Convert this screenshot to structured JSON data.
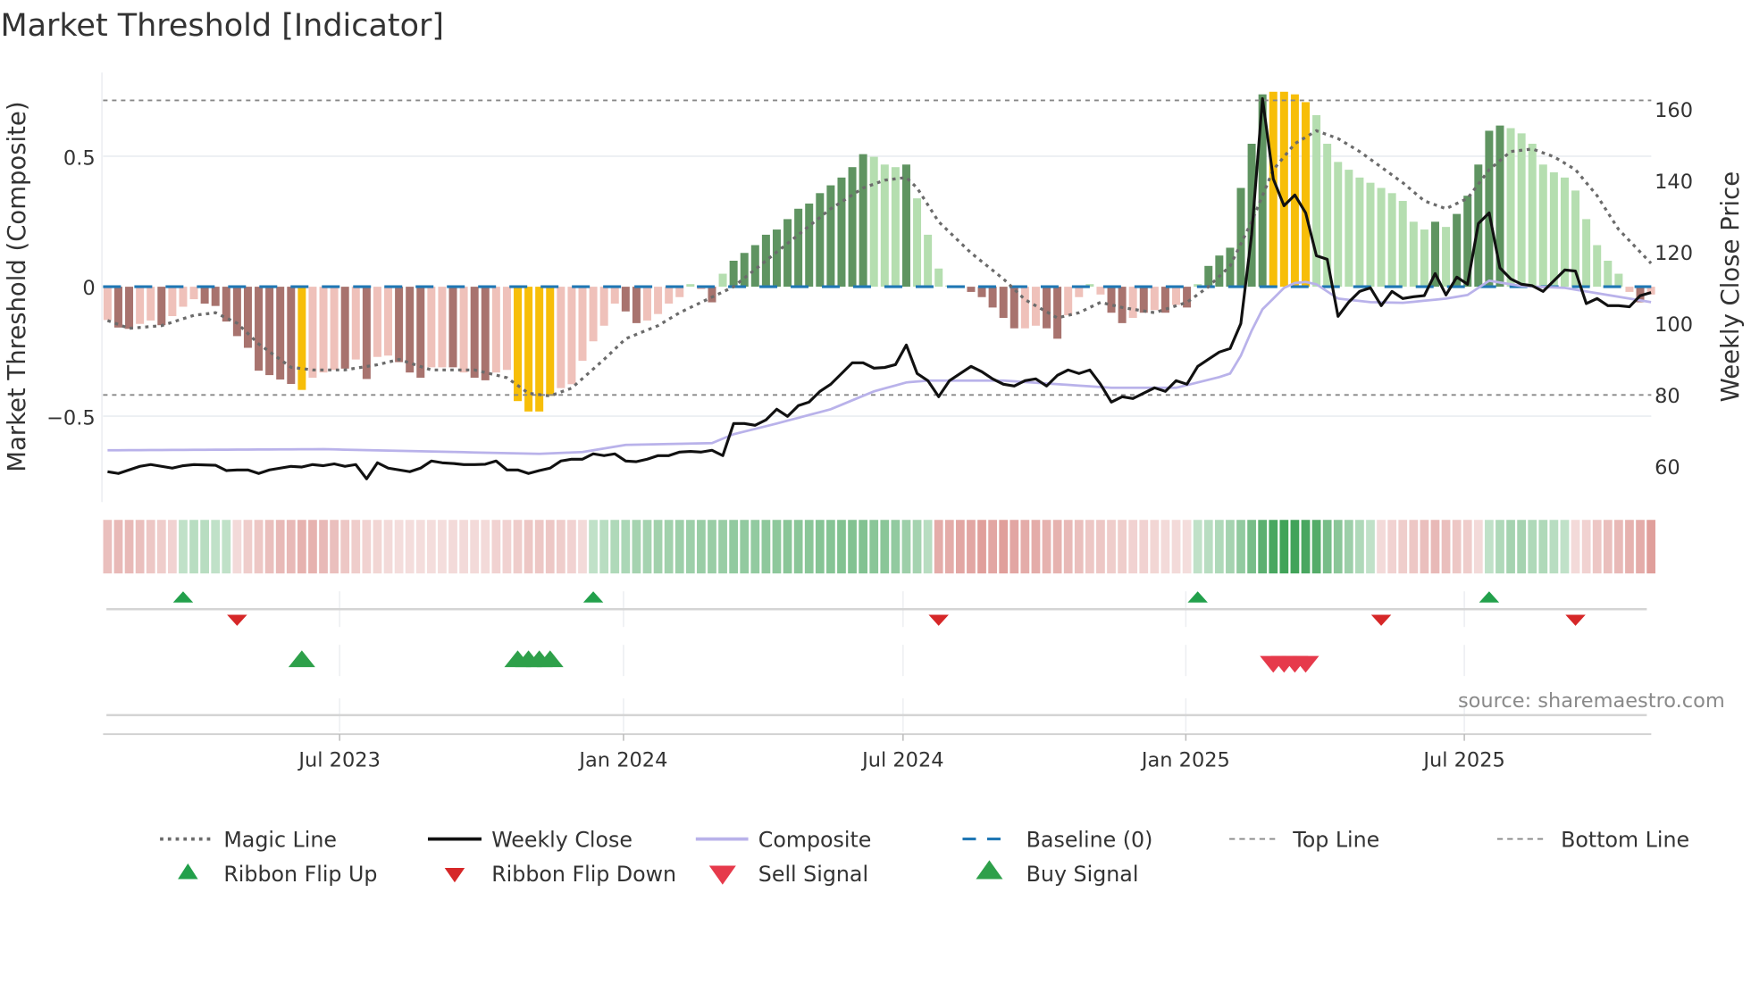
{
  "title": "Market Threshold [Indicator]",
  "source": "source: sharemaestro.com",
  "chart_data": {
    "type": "bar+line",
    "title": "Market Threshold [Indicator]",
    "ylabel_left": "Market Threshold (Composite)",
    "ylabel_right": "Weekly Close Price",
    "ylim_left": [
      -0.82,
      0.82
    ],
    "ylim_right": [
      50,
      170
    ],
    "left_ticks": [
      {
        "label": "0.5",
        "value": 0.5
      },
      {
        "label": "0",
        "value": 0
      },
      {
        "label": "−0.5",
        "value": -0.5
      }
    ],
    "right_ticks": [
      {
        "label": "160",
        "value": 160
      },
      {
        "label": "140",
        "value": 140
      },
      {
        "label": "120",
        "value": 120
      },
      {
        "label": "100",
        "value": 100
      },
      {
        "label": "80",
        "value": 80
      },
      {
        "label": "60",
        "value": 60
      }
    ],
    "x_ticks": [
      {
        "label": "Jul 2023",
        "week": 21.5
      },
      {
        "label": "Jan 2024",
        "week": 47.8
      },
      {
        "label": "Jul 2024",
        "week": 73.7
      },
      {
        "label": "Jan 2025",
        "week": 99.9
      },
      {
        "label": "Jul 2025",
        "week": 125.7
      }
    ],
    "weeks": 144,
    "top_line_price": 162.5,
    "bottom_line_price": 80,
    "baseline": 0,
    "bar_color_key": {
      "D": "#a8736e",
      "L": "#efc1ba",
      "G": "#5f9461",
      "g": "#b5deb0",
      "Y": "#f7be08"
    },
    "bar_codes": "LDDLLDLLLDDDDDDDDDYLLLDLDLLDDDLLDLDDLLYYYYLLLLLLDDLLLLgLDgGGGGGGGGGGGGGgggGggggLDDDDDLLDDLLgLDDLDLDLDgGGGGGGYYYYgggggggggggGgGGGGGgggggggggggLDL",
    "composite_bars": [
      -0.128,
      -0.157,
      -0.162,
      -0.143,
      -0.13,
      -0.148,
      -0.113,
      -0.077,
      -0.048,
      -0.065,
      -0.074,
      -0.134,
      -0.19,
      -0.235,
      -0.323,
      -0.34,
      -0.357,
      -0.374,
      -0.397,
      -0.35,
      -0.33,
      -0.32,
      -0.315,
      -0.28,
      -0.355,
      -0.27,
      -0.265,
      -0.29,
      -0.33,
      -0.35,
      -0.31,
      -0.31,
      -0.31,
      -0.33,
      -0.35,
      -0.36,
      -0.33,
      -0.32,
      -0.44,
      -0.48,
      -0.48,
      -0.42,
      -0.39,
      -0.375,
      -0.285,
      -0.21,
      -0.15,
      -0.065,
      -0.095,
      -0.14,
      -0.13,
      -0.105,
      -0.065,
      -0.04,
      0.01,
      -0.01,
      -0.06,
      0.05,
      0.1,
      0.13,
      0.16,
      0.2,
      0.22,
      0.26,
      0.3,
      0.32,
      0.36,
      0.39,
      0.42,
      0.46,
      0.51,
      0.5,
      0.47,
      0.46,
      0.47,
      0.34,
      0.2,
      0.07,
      0.005,
      -0.005,
      -0.02,
      -0.04,
      -0.08,
      -0.12,
      -0.16,
      -0.16,
      -0.15,
      -0.16,
      -0.2,
      -0.11,
      -0.04,
      0.01,
      -0.03,
      -0.1,
      -0.14,
      -0.12,
      -0.1,
      -0.09,
      -0.1,
      -0.07,
      -0.08,
      0.01,
      0.08,
      0.12,
      0.15,
      0.38,
      0.55,
      0.74,
      0.75,
      0.75,
      0.74,
      0.71,
      0.66,
      0.55,
      0.48,
      0.45,
      0.42,
      0.4,
      0.38,
      0.36,
      0.33,
      0.25,
      0.22,
      0.25,
      0.23,
      0.28,
      0.35,
      0.47,
      0.6,
      0.62,
      0.61,
      0.59,
      0.55,
      0.47,
      0.44,
      0.42,
      0.37,
      0.26,
      0.16,
      0.1,
      0.05,
      -0.02,
      -0.06,
      -0.03
    ],
    "magic_line_points": [
      [
        0,
        -0.13
      ],
      [
        2,
        -0.16
      ],
      [
        5,
        -0.15
      ],
      [
        8,
        -0.11
      ],
      [
        10,
        -0.1
      ],
      [
        12,
        -0.14
      ],
      [
        14,
        -0.22
      ],
      [
        17,
        -0.31
      ],
      [
        19,
        -0.32
      ],
      [
        22,
        -0.32
      ],
      [
        25,
        -0.3
      ],
      [
        27,
        -0.28
      ],
      [
        30,
        -0.32
      ],
      [
        34,
        -0.32
      ],
      [
        37,
        -0.35
      ],
      [
        39,
        -0.41
      ],
      [
        41,
        -0.42
      ],
      [
        43,
        -0.39
      ],
      [
        46,
        -0.28
      ],
      [
        48,
        -0.2
      ],
      [
        51,
        -0.15
      ],
      [
        53,
        -0.1
      ],
      [
        56,
        -0.04
      ],
      [
        58,
        0.0
      ],
      [
        61,
        0.1
      ],
      [
        64,
        0.2
      ],
      [
        67,
        0.3
      ],
      [
        70,
        0.38
      ],
      [
        72,
        0.41
      ],
      [
        74,
        0.42
      ],
      [
        75,
        0.38
      ],
      [
        77,
        0.25
      ],
      [
        80,
        0.13
      ],
      [
        83,
        0.03
      ],
      [
        85,
        -0.05
      ],
      [
        88,
        -0.12
      ],
      [
        90,
        -0.1
      ],
      [
        92,
        -0.06
      ],
      [
        94,
        -0.08
      ],
      [
        97,
        -0.1
      ],
      [
        100,
        -0.06
      ],
      [
        102,
        0.0
      ],
      [
        104,
        0.08
      ],
      [
        106,
        0.25
      ],
      [
        108,
        0.45
      ],
      [
        110,
        0.55
      ],
      [
        112,
        0.6
      ],
      [
        114,
        0.57
      ],
      [
        116,
        0.52
      ],
      [
        118,
        0.46
      ],
      [
        120,
        0.4
      ],
      [
        122,
        0.33
      ],
      [
        124,
        0.3
      ],
      [
        126,
        0.34
      ],
      [
        128,
        0.45
      ],
      [
        130,
        0.52
      ],
      [
        132,
        0.53
      ],
      [
        134,
        0.5
      ],
      [
        136,
        0.45
      ],
      [
        138,
        0.35
      ],
      [
        140,
        0.22
      ],
      [
        143,
        0.09
      ]
    ],
    "weekly_close": [
      58.5,
      58,
      59,
      60,
      60.5,
      60,
      59.5,
      60.2,
      60.5,
      60.4,
      60.3,
      58.8,
      59,
      59,
      58,
      59,
      59.5,
      60,
      59.8,
      60.5,
      60.2,
      60.7,
      60,
      60.5,
      56.5,
      61,
      59.5,
      59,
      58.5,
      59.5,
      61.5,
      61,
      60.8,
      60.5,
      60.5,
      60.6,
      61.5,
      59,
      59,
      58,
      58.8,
      59.5,
      61.5,
      62,
      62,
      63.5,
      63,
      63.5,
      61.5,
      61.3,
      62,
      63,
      63,
      64,
      64.2,
      64,
      64.5,
      63,
      72,
      72,
      71.5,
      73,
      76,
      74,
      77,
      78,
      81,
      83,
      86,
      89,
      89,
      87.5,
      87.7,
      88.5,
      94,
      86,
      84,
      79.5,
      84,
      86,
      88,
      86.5,
      84.5,
      83,
      82.5,
      84,
      84.5,
      82.5,
      85.5,
      87,
      86,
      87,
      83,
      78,
      79.5,
      79,
      80.5,
      82,
      81,
      84,
      83,
      88,
      90,
      92,
      93,
      100,
      125,
      163,
      140.5,
      133,
      136,
      131,
      119,
      118,
      102,
      106,
      109,
      110,
      105,
      109,
      107,
      107.5,
      107.8,
      114,
      108,
      113,
      111,
      128,
      131,
      115.6,
      112.5,
      111,
      110.6,
      109,
      112,
      115,
      114.7,
      105.6,
      107,
      105,
      105,
      104.7,
      107.8,
      108.7
    ],
    "composite_line_points": [
      [
        0,
        64.5
      ],
      [
        20,
        64.8
      ],
      [
        40,
        63.5
      ],
      [
        44,
        64
      ],
      [
        48,
        66
      ],
      [
        56,
        66.5
      ],
      [
        58,
        69
      ],
      [
        62,
        72
      ],
      [
        67,
        76
      ],
      [
        71,
        81
      ],
      [
        74,
        83.5
      ],
      [
        76,
        84
      ],
      [
        83,
        84
      ],
      [
        88,
        83
      ],
      [
        93,
        82
      ],
      [
        99,
        82
      ],
      [
        103,
        85
      ],
      [
        104,
        86
      ],
      [
        105,
        91
      ],
      [
        106,
        98
      ],
      [
        107,
        104
      ],
      [
        109,
        110
      ],
      [
        110.5,
        112
      ],
      [
        112,
        111
      ],
      [
        114,
        107
      ],
      [
        117,
        106
      ],
      [
        120,
        105.8
      ],
      [
        124,
        107
      ],
      [
        126,
        108
      ],
      [
        128,
        112
      ],
      [
        131,
        110.5
      ],
      [
        135,
        110
      ],
      [
        139,
        108
      ],
      [
        143,
        106
      ]
    ],
    "ribbon": [
      -0.35,
      -0.4,
      -0.4,
      -0.35,
      -0.3,
      -0.25,
      -0.2,
      0.2,
      0.25,
      0.25,
      0.2,
      0.2,
      -0.15,
      -0.25,
      -0.3,
      -0.35,
      -0.4,
      -0.4,
      -0.45,
      -0.45,
      -0.4,
      -0.35,
      -0.3,
      -0.25,
      -0.2,
      -0.18,
      -0.15,
      -0.12,
      -0.12,
      -0.12,
      -0.12,
      -0.12,
      -0.15,
      -0.15,
      -0.15,
      -0.15,
      -0.2,
      -0.2,
      -0.25,
      -0.3,
      -0.3,
      -0.3,
      -0.25,
      -0.2,
      -0.15,
      0.2,
      0.25,
      0.3,
      0.32,
      0.35,
      0.35,
      0.38,
      0.38,
      0.4,
      0.4,
      0.42,
      0.42,
      0.42,
      0.45,
      0.45,
      0.45,
      0.48,
      0.48,
      0.5,
      0.5,
      0.5,
      0.52,
      0.52,
      0.55,
      0.55,
      0.55,
      0.5,
      0.5,
      0.45,
      0.4,
      0.35,
      0.25,
      -0.5,
      -0.5,
      -0.55,
      -0.55,
      -0.6,
      -0.55,
      -0.6,
      -0.55,
      -0.5,
      -0.5,
      -0.45,
      -0.45,
      -0.4,
      -0.35,
      -0.3,
      -0.3,
      -0.25,
      -0.25,
      -0.2,
      -0.2,
      -0.18,
      -0.15,
      -0.15,
      -0.12,
      0.2,
      0.25,
      0.3,
      0.35,
      0.45,
      0.6,
      0.75,
      0.85,
      0.9,
      0.9,
      0.85,
      0.8,
      0.6,
      0.5,
      0.4,
      0.3,
      0.2,
      -0.15,
      -0.2,
      -0.25,
      -0.3,
      -0.35,
      -0.4,
      -0.35,
      -0.3,
      -0.25,
      -0.15,
      0.2,
      0.3,
      0.35,
      0.35,
      0.3,
      0.3,
      0.25,
      0.2,
      -0.15,
      -0.2,
      -0.3,
      -0.35,
      -0.4,
      -0.45,
      -0.5,
      -0.6
    ],
    "ribbon_flip_up_weeks": [
      7,
      45,
      101,
      128
    ],
    "ribbon_flip_down_weeks": [
      12,
      77,
      118,
      136
    ],
    "buy_signal_weeks": [
      18,
      38,
      39,
      40,
      41
    ],
    "sell_signal_weeks": [
      108,
      109,
      110,
      111
    ],
    "colors": {
      "magic": "#6b6b6b",
      "close": "#111111",
      "composite": "#b9b2ea",
      "baseline": "#1f77b4",
      "flip_up": "#22a04b",
      "flip_down": "#d62728",
      "sell": "#e63a4b",
      "buy": "#2ea04a",
      "ribbon_green": "#2e9a48",
      "ribbon_red": "#cf6b66"
    }
  },
  "legend": {
    "row1": [
      "Magic Line",
      "Weekly Close",
      "Composite",
      "Baseline (0)",
      "Top Line",
      "Bottom Line"
    ],
    "row2": [
      "Ribbon Flip Up",
      "Ribbon Flip Down",
      "Sell Signal",
      "Buy Signal"
    ]
  }
}
